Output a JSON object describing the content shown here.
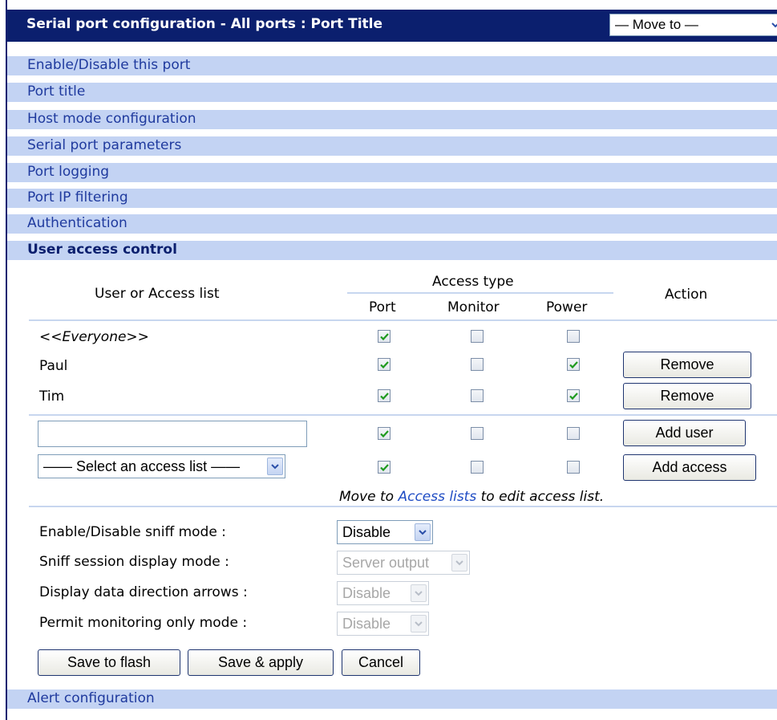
{
  "header": {
    "title": "Serial port configuration - All ports : Port Title",
    "move_to": "— Move to —"
  },
  "sections": [
    {
      "label": "Enable/Disable this port"
    },
    {
      "label": "Port title"
    },
    {
      "label": "Host mode configuration"
    },
    {
      "label": "Serial port parameters"
    },
    {
      "label": "Port logging"
    },
    {
      "label": "Port IP filtering"
    },
    {
      "label": "Authentication"
    },
    {
      "label": "User access control"
    }
  ],
  "footer_section": "Alert configuration",
  "table": {
    "col_user": "User or Access list",
    "col_access_type": "Access type",
    "col_port": "Port",
    "col_monitor": "Monitor",
    "col_power": "Power",
    "col_action": "Action",
    "rows": [
      {
        "user": "<<Everyone>>",
        "port": true,
        "monitor": false,
        "power": false,
        "action": ""
      },
      {
        "user": "Paul",
        "port": true,
        "monitor": false,
        "power": true,
        "action": "Remove"
      },
      {
        "user": "Tim",
        "port": true,
        "monitor": false,
        "power": true,
        "action": "Remove"
      }
    ],
    "add_user": {
      "value": "",
      "port": true,
      "monitor": false,
      "power": false,
      "button": "Add user"
    },
    "add_access": {
      "select": "—— Select an access list ——",
      "port": true,
      "monitor": false,
      "power": false,
      "button": "Add access"
    },
    "note_prefix": "Move to ",
    "note_link": "Access lists",
    "note_suffix": " to edit access list."
  },
  "settings": [
    {
      "label": "Enable/Disable sniff mode :",
      "value": "Disable",
      "enabled": true
    },
    {
      "label": "Sniff session display mode :",
      "value": "Server output",
      "enabled": false
    },
    {
      "label": "Display data direction arrows :",
      "value": "Disable",
      "enabled": false
    },
    {
      "label": "Permit monitoring only mode :",
      "value": "Disable",
      "enabled": false
    }
  ],
  "buttons": {
    "save_flash": "Save to flash",
    "save_apply": "Save & apply",
    "cancel": "Cancel"
  },
  "colors": {
    "header_bg": "#0b1f6e",
    "nav_bg": "#c3d3f3",
    "link": "#1f3a9e"
  }
}
